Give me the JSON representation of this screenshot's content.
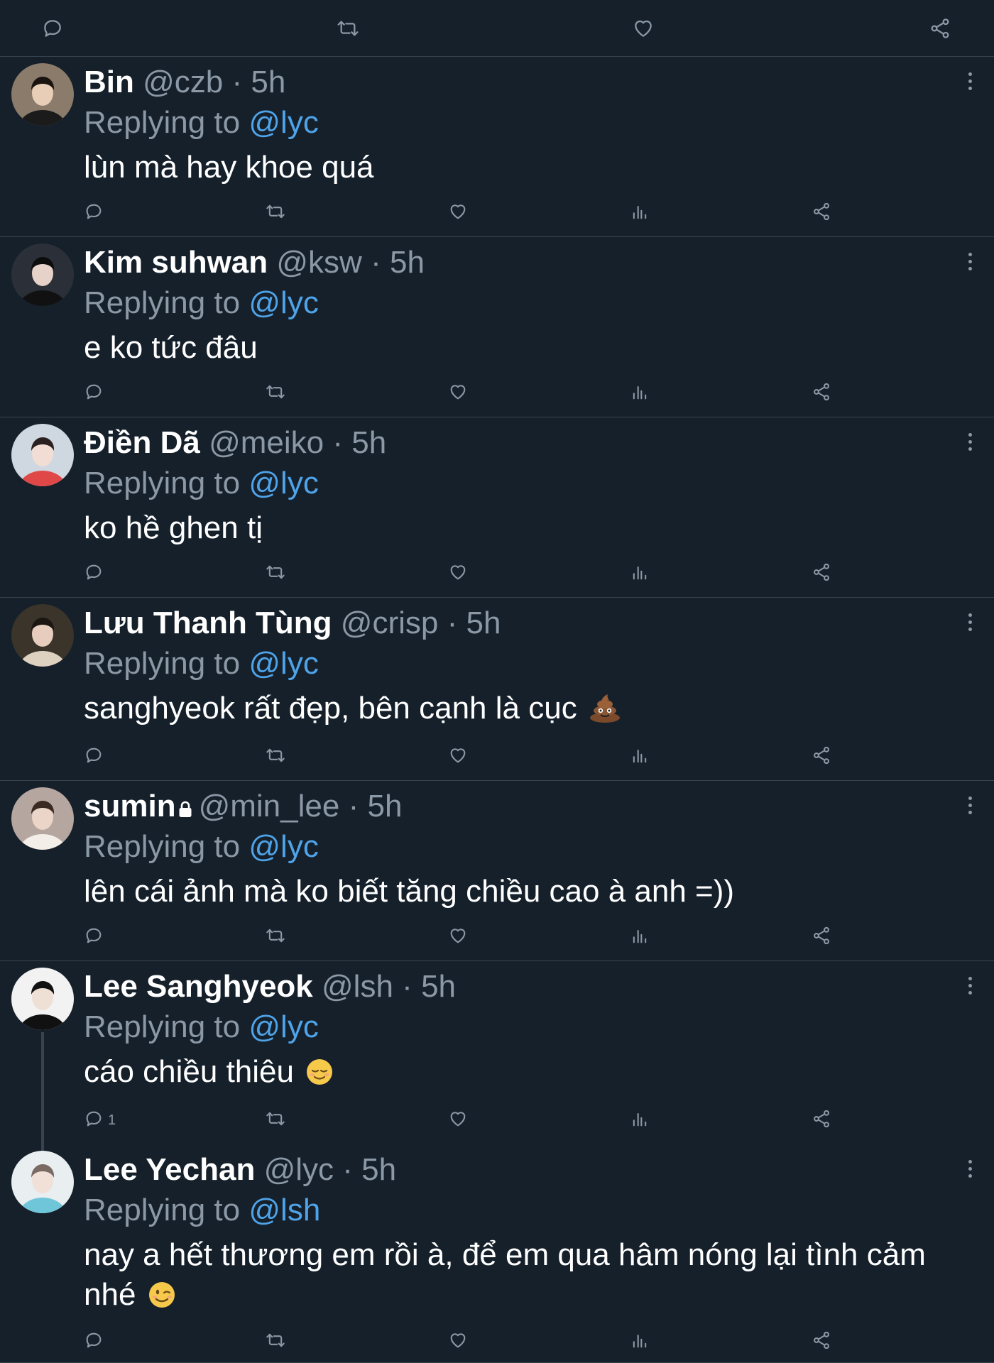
{
  "top_actions": [
    "reply-icon",
    "retweet-icon",
    "like-icon",
    "share-icon"
  ],
  "tweets": [
    {
      "name": "Bin",
      "handle": "@czb",
      "dot": "·",
      "time": "5h",
      "replying_label": "Replying to",
      "replying_to": "@lyc",
      "text": "lùn mà hay khoe quá"
    },
    {
      "name": "Kim suhwan",
      "handle": "@ksw",
      "dot": "·",
      "time": "5h",
      "replying_label": "Replying to",
      "replying_to": "@lyc",
      "text": "e ko tức đâu"
    },
    {
      "name": "Điền Dã",
      "handle": "@meiko",
      "dot": "·",
      "time": "5h",
      "replying_label": "Replying to",
      "replying_to": "@lyc",
      "text": "ko hề ghen tị"
    },
    {
      "name": "Lưu Thanh Tùng",
      "handle": "@crisp",
      "dot": "·",
      "time": "5h",
      "replying_label": "Replying to",
      "replying_to": "@lyc",
      "text": "sanghyeok rất đẹp, bên cạnh là cục",
      "emoji": "poop"
    },
    {
      "name": "sumin",
      "handle": "@min_lee",
      "dot": "·",
      "time": "5h",
      "replying_label": "Replying to",
      "replying_to": "@lyc",
      "text": "lên cái ảnh mà ko biết tăng chiều cao à  anh =))",
      "locked": true
    },
    {
      "name": "Lee Sanghyeok",
      "handle": "@lsh",
      "dot": "·",
      "time": "5h",
      "replying_label": "Replying to",
      "replying_to": "@lyc",
      "text": "cáo chiều thiêu",
      "emoji": "relieved",
      "reply_count": "1"
    },
    {
      "name": "Lee Yechan",
      "handle": "@lyc",
      "dot": "·",
      "time": "5h",
      "replying_label": "Replying to",
      "replying_to": "@lsh",
      "text": "nay a hết thương em rồi à, để em qua hâm nóng lại tình cảm nhé",
      "emoji": "wink"
    }
  ],
  "colors": {
    "background": "#15202b",
    "divider": "#38444d",
    "secondary_text": "#8b98a5",
    "mention": "#4fa3e8"
  }
}
